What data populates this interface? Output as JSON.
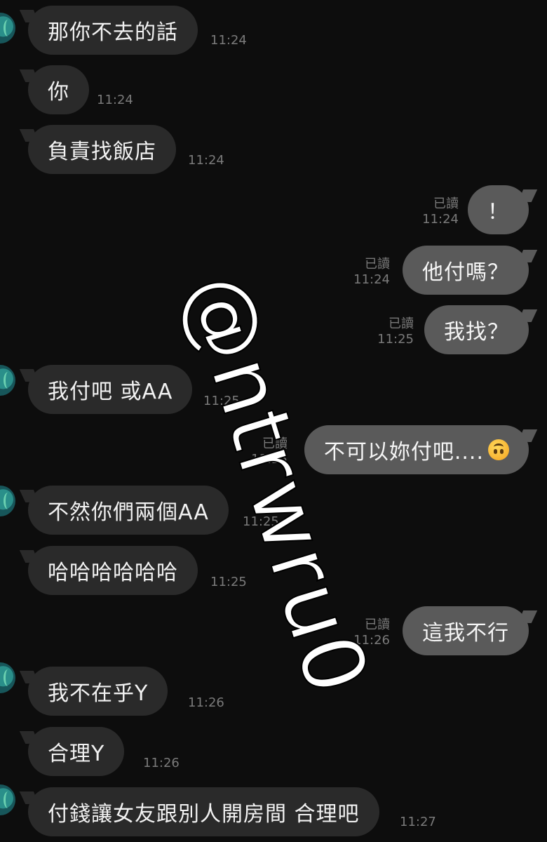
{
  "messages": [
    {
      "side": "in",
      "avatar": true,
      "text": "那你不去的話",
      "time": "11:24"
    },
    {
      "side": "in",
      "text": "你",
      "time": "11:24"
    },
    {
      "side": "in",
      "text": "負責找飯店",
      "time": "11:24"
    },
    {
      "side": "out",
      "text": "！",
      "read": "已讀",
      "time": "11:24"
    },
    {
      "side": "out",
      "text": "他付嗎？",
      "read": "已讀",
      "time": "11:24"
    },
    {
      "side": "out",
      "text": "我找？",
      "read": "已讀",
      "time": "11:25"
    },
    {
      "side": "in",
      "avatar": true,
      "text": "我付吧 或AA",
      "time": "11:25"
    },
    {
      "side": "out",
      "text": "不可以妳付吧....",
      "emoji": "upside-down-face-emoji",
      "read": "已讀",
      "time": "11:25"
    },
    {
      "side": "in",
      "avatar": true,
      "text": "不然你們兩個AA",
      "time": "11:25"
    },
    {
      "side": "in",
      "text": "哈哈哈哈哈哈",
      "time": "11:25"
    },
    {
      "side": "out",
      "text": "這我不行",
      "read": "已讀",
      "time": "11:26"
    },
    {
      "side": "in",
      "avatar": true,
      "text": "我不在乎Y",
      "time": "11:26"
    },
    {
      "side": "in",
      "text": "合理Y",
      "time": "11:26"
    },
    {
      "side": "in",
      "avatar": true,
      "text": "付錢讓女友跟別人開房間 合理吧",
      "time": "11:27"
    }
  ],
  "watermark": "@ntrwru0"
}
